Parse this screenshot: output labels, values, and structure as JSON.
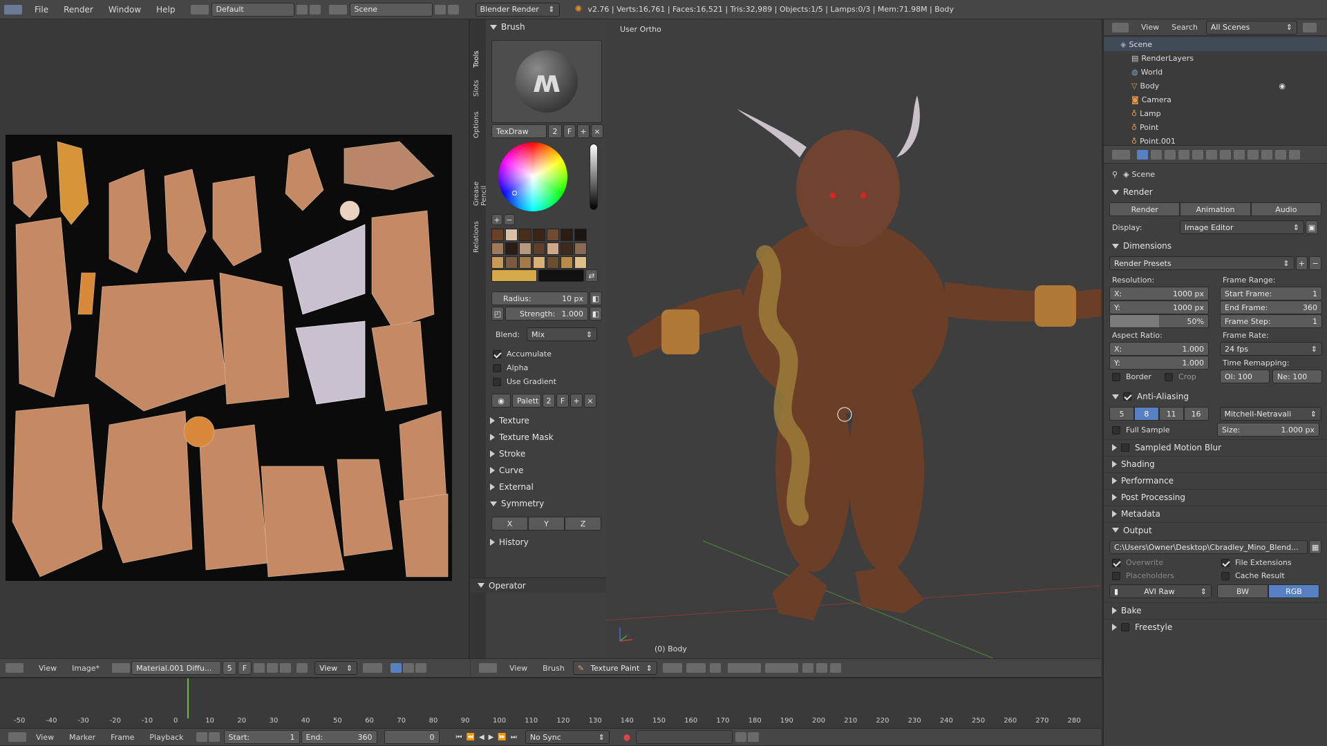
{
  "topbar": {
    "menus": [
      "File",
      "Render",
      "Window",
      "Help"
    ],
    "layout": "Default",
    "scene": "Scene",
    "engine": "Blender Render",
    "stats": "v2.76 | Verts:16,761 | Faces:16,521 | Tris:32,989 | Objects:1/5 | Lamps:0/3 | Mem:71.98M | Body"
  },
  "tools": {
    "tabs": [
      "Tools",
      "Slots",
      "Options",
      "Grease Pencil",
      "Relations"
    ],
    "brush_header": "Brush",
    "brush_name": "TexDraw",
    "brush_users": "2",
    "fake": "F",
    "radius": "Radius:",
    "radius_val": "10 px",
    "strength": "Strength:",
    "strength_val": "1.000",
    "blend_label": "Blend:",
    "blend_val": "Mix",
    "accumulate": "Accumulate",
    "alpha": "Alpha",
    "use_gradient": "Use Gradient",
    "palette": "Palett",
    "palette_users": "2",
    "sections": [
      "Texture",
      "Texture Mask",
      "Stroke",
      "Curve",
      "External"
    ],
    "symmetry": "Symmetry",
    "sym_axes": [
      "X",
      "Y",
      "Z"
    ],
    "history": "History",
    "operator": "Operator"
  },
  "swatches": [
    "#6b4226",
    "#d9bfa6",
    "#4b2d1c",
    "#3a2417",
    "#6e4a33",
    "#2a1c13",
    "#1b1512",
    "#a0785a",
    "#2b1d14",
    "#b8977c",
    "#5e3f2b",
    "#cda98a",
    "#3e2a1d",
    "#8b6a52",
    "#c79a58",
    "#7a5a40",
    "#a47a4a",
    "#d7b07a",
    "#6a4c30",
    "#b88b4a",
    "#e0c08a"
  ],
  "viewport": {
    "label": "User Ortho",
    "object": "(0) Body",
    "header": [
      "View",
      "Brush"
    ],
    "mode": "Texture Paint"
  },
  "uv_header": {
    "menus": [
      "View",
      "Image*"
    ],
    "material": "Material.001 Diffu...",
    "users": "5",
    "fake": "F",
    "view": "View"
  },
  "outliner": {
    "menus": [
      "View",
      "Search"
    ],
    "filter": "All Scenes",
    "items": [
      "Scene",
      "RenderLayers",
      "World",
      "Body",
      "Camera",
      "Lamp",
      "Point",
      "Point.001"
    ]
  },
  "props": {
    "context": "Scene",
    "render": "Render",
    "buttons": [
      "Render",
      "Animation",
      "Audio"
    ],
    "display_label": "Display:",
    "display_val": "Image Editor",
    "dimensions": "Dimensions",
    "presets": "Render Presets",
    "resolution": "Resolution:",
    "res_x": "X:",
    "res_x_val": "1000 px",
    "res_y": "Y:",
    "res_y_val": "1000 px",
    "res_pct": "50%",
    "frame_range": "Frame Range:",
    "start_frame": "Start Frame:",
    "start_val": "1",
    "end_frame": "End Frame:",
    "end_val": "360",
    "frame_step": "Frame Step:",
    "step_val": "1",
    "aspect": "Aspect Ratio:",
    "asp_x": "X:",
    "asp_x_val": "1.000",
    "asp_y": "Y:",
    "asp_y_val": "1.000",
    "frame_rate": "Frame Rate:",
    "fps": "24 fps",
    "border": "Border",
    "crop": "Crop",
    "time_remap": "Time Remapping:",
    "old": "Ol: 100",
    "new": "Ne: 100",
    "aa": "Anti-Aliasing",
    "aa_samples": [
      "5",
      "8",
      "11",
      "16"
    ],
    "filter": "Mitchell-Netravali",
    "full_sample": "Full Sample",
    "size": "Size:",
    "size_val": "1.000 px",
    "smb": "Sampled Motion Blur",
    "shading": "Shading",
    "performance": "Performance",
    "post": "Post Processing",
    "metadata": "Metadata",
    "output": "Output",
    "path": "C:\\Users\\Owner\\Desktop\\Cbradley_Mino_Blend...",
    "overwrite": "Overwrite",
    "file_ext": "File Extensions",
    "placeholders": "Placeholders",
    "cache": "Cache Result",
    "format": "AVI Raw",
    "bw": "BW",
    "rgb": "RGB",
    "bake": "Bake",
    "freestyle": "Freestyle"
  },
  "timeline": {
    "ticks": [
      "-50",
      "-40",
      "-30",
      "-20",
      "-10",
      "0",
      "10",
      "20",
      "30",
      "40",
      "50",
      "60",
      "70",
      "80",
      "90",
      "100",
      "110",
      "120",
      "130",
      "140",
      "150",
      "160",
      "170",
      "180",
      "190",
      "200",
      "210",
      "220",
      "230",
      "240",
      "250",
      "260",
      "270",
      "280"
    ],
    "menus": [
      "View",
      "Marker",
      "Frame",
      "Playback"
    ],
    "start": "Start:",
    "start_val": "1",
    "end": "End:",
    "end_val": "360",
    "current": "0",
    "sync": "No Sync"
  },
  "colors": {
    "accent": "#5680c2",
    "bg": "#393939",
    "header": "#464646"
  }
}
